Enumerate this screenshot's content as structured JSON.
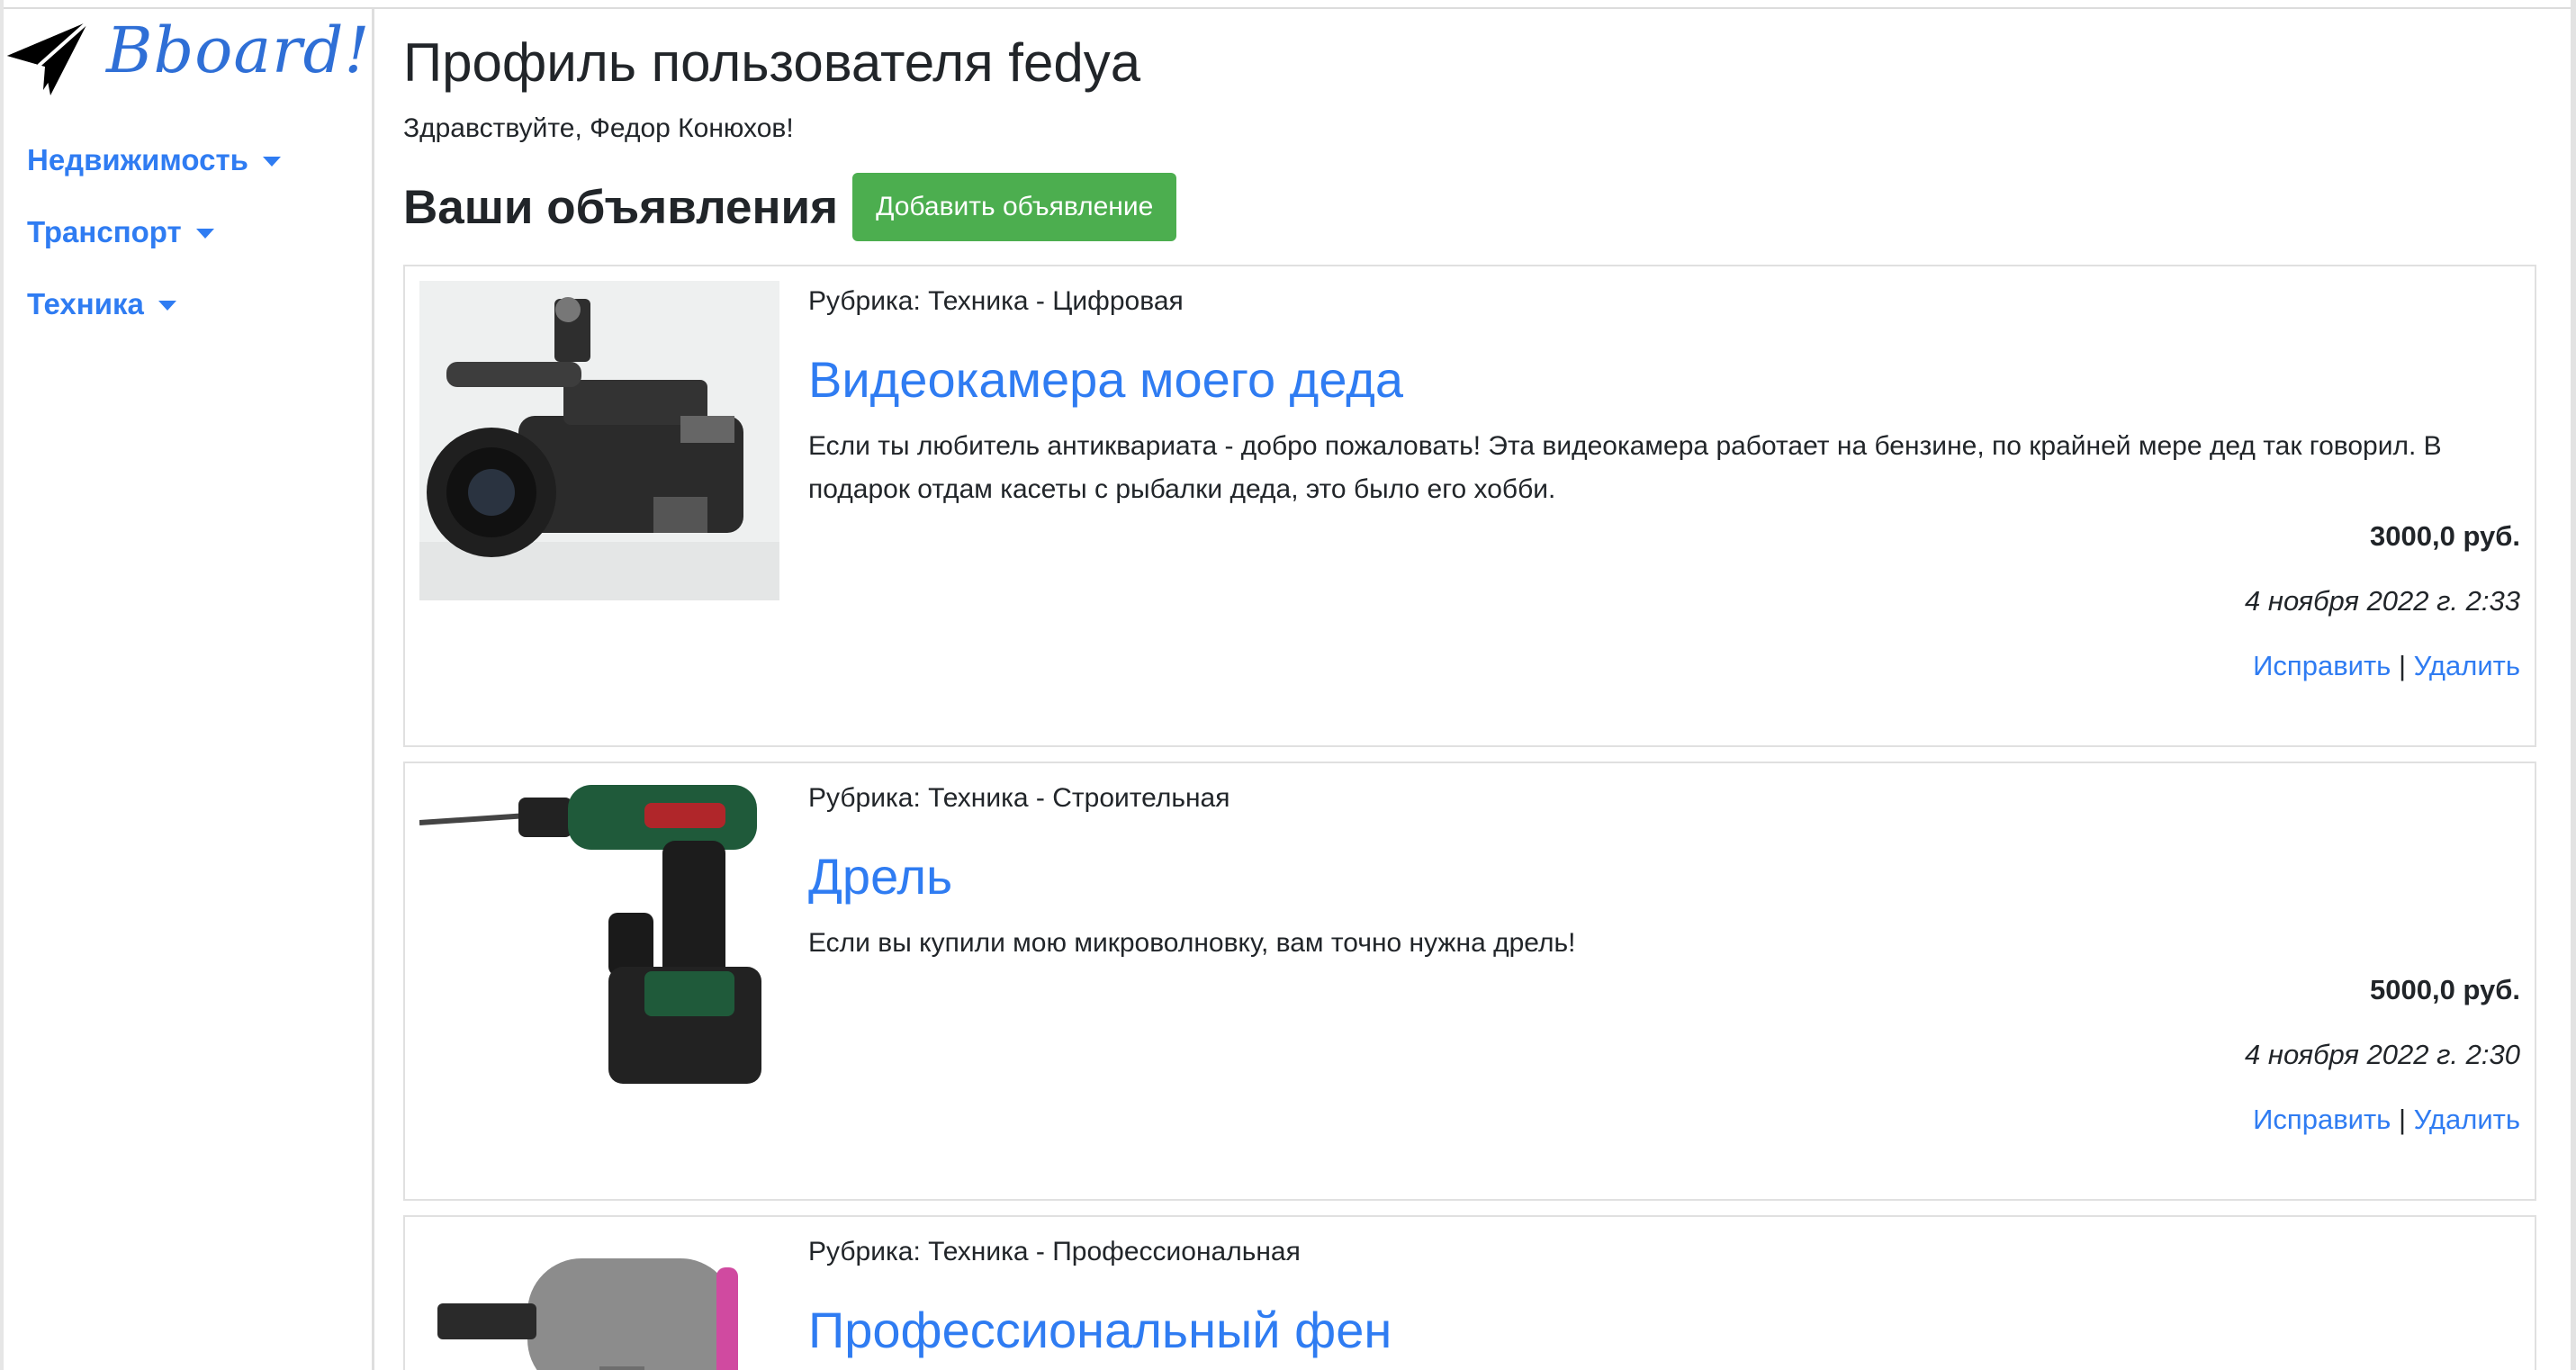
{
  "brand": {
    "name": "Bboard!",
    "icon": "paper-plane-icon"
  },
  "nav": {
    "items": [
      {
        "label": "Недвижимость"
      },
      {
        "label": "Транспорт"
      },
      {
        "label": "Техника"
      }
    ]
  },
  "profile": {
    "title": "Профиль пользователя fedya",
    "greeting": "Здравствуйте, Федор Конюхов!"
  },
  "ads_section": {
    "title": "Ваши объявления",
    "add_button": "Добавить объявление"
  },
  "ads": [
    {
      "rubric": "Рубрика: Техника - Цифровая",
      "title": "Видеокамера моего деда",
      "text": "Если ты любитель антиквариата - добро пожаловать! Эта видеокамера работает на бензине, по крайней мере дед так говорил. В подарок отдам касеты с рыбалки деда, это было его хобби.",
      "price": "3000,0 руб.",
      "date": "4 ноября 2022 г. 2:33",
      "edit": "Исправить",
      "separator": "|",
      "delete": "Удалить",
      "image": "camcorder-photo"
    },
    {
      "rubric": "Рубрика: Техника - Строительная",
      "title": "Дрель",
      "text": "Если вы купили мою микроволновку, вам точно нужна дрель!",
      "price": "5000,0 руб.",
      "date": "4 ноября 2022 г. 2:30",
      "edit": "Исправить",
      "separator": "|",
      "delete": "Удалить",
      "image": "drill-photo"
    },
    {
      "rubric": "Рубрика: Техника - Профессиональная",
      "title": "Профессиональный фен",
      "image": "hair-dryer-photo"
    }
  ],
  "colors": {
    "link": "#2f7cf2",
    "button": "#4cae4f",
    "brand": "#2f6fd6"
  }
}
